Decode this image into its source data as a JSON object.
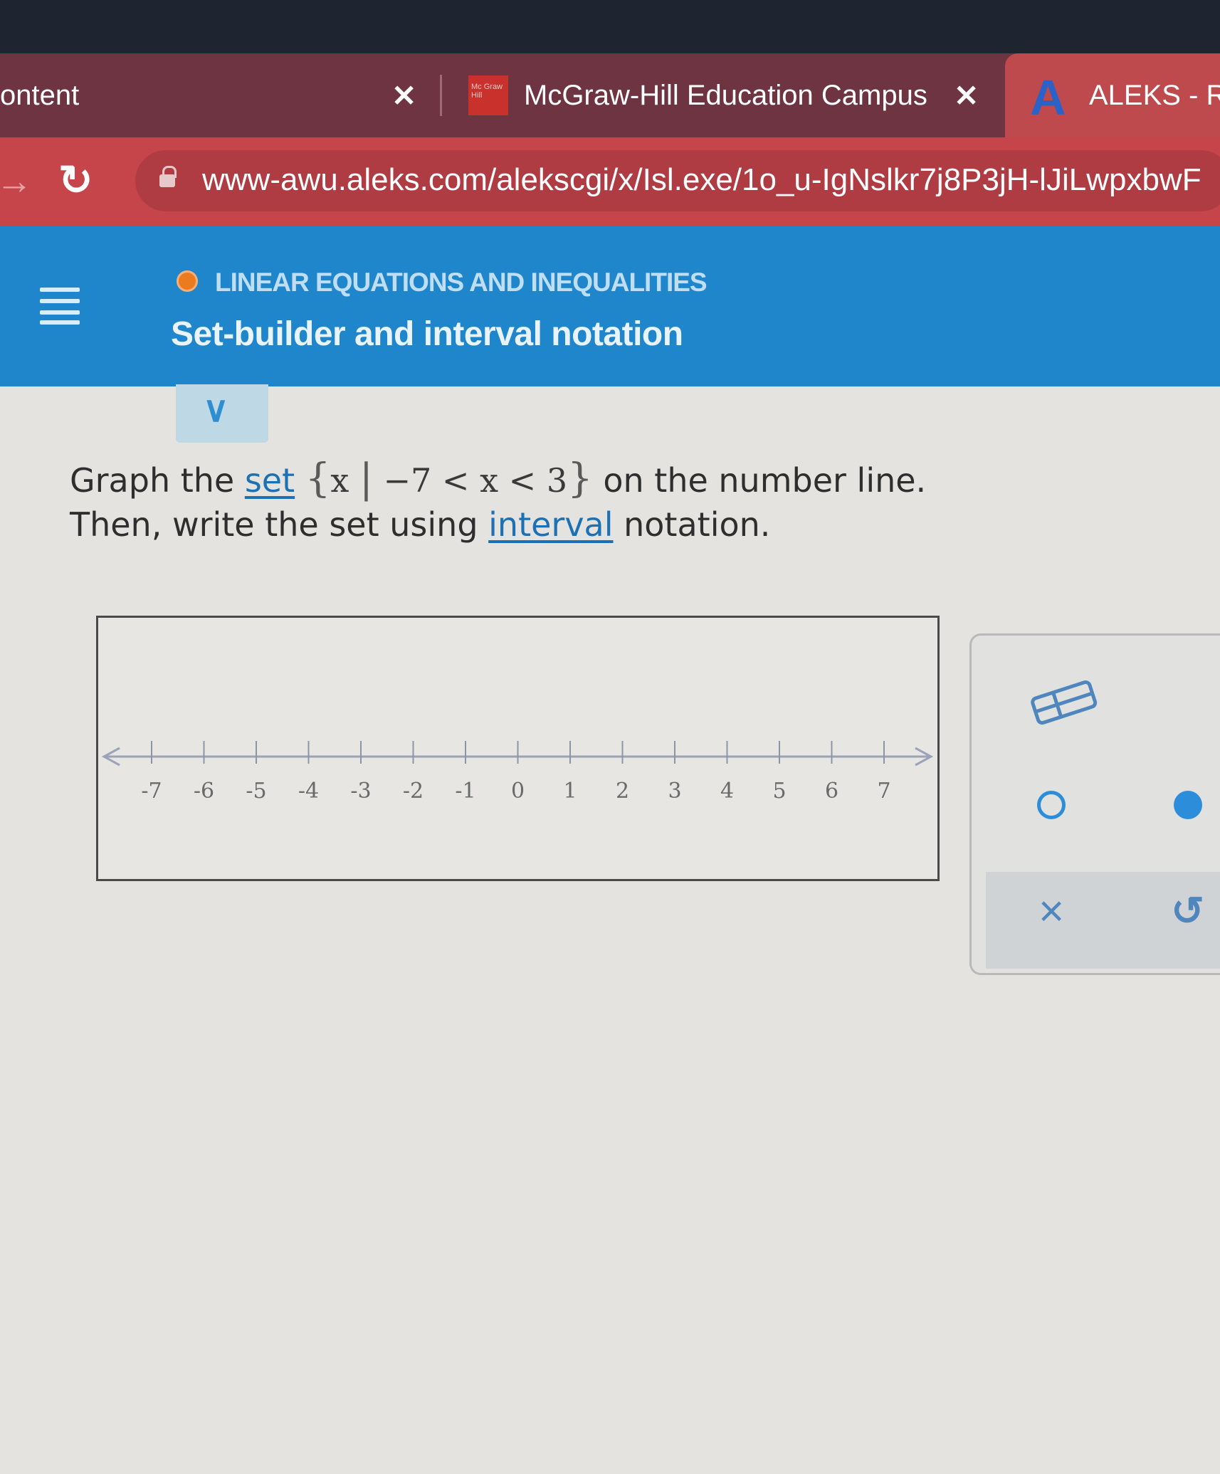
{
  "browser": {
    "tabs": [
      {
        "label": "ontent",
        "close": "✕"
      },
      {
        "label": "McGraw-Hill Education Campus",
        "close": "✕",
        "logo_text": "Mc Graw Hill"
      },
      {
        "label": "ALEKS - R",
        "logo": "A"
      }
    ],
    "url": "www-awu.aleks.com/alekscgi/x/Isl.exe/1o_u-IgNslkr7j8P3jH-lJiLwpxbwF"
  },
  "aleks_header": {
    "topic": "LINEAR EQUATIONS AND INEQUALITIES",
    "title": "Set-builder and interval notation",
    "topic_dot_color": "#ec7a1f"
  },
  "problem": {
    "line1_prefix": "Graph the ",
    "set_link": "set",
    "set_open": "{",
    "set_var": "x",
    "set_bar": "|",
    "set_condition": "−7 < x < 3",
    "set_close": "}",
    "line1_suffix": " on the number line.",
    "line2_prefix": "Then, write the set using ",
    "interval_link": "interval",
    "line2_suffix": " notation."
  },
  "number_line": {
    "min": -7,
    "max": 7,
    "ticks": [
      "-7",
      "-6",
      "-5",
      "-4",
      "-3",
      "-2",
      "-1",
      "0",
      "1",
      "2",
      "3",
      "4",
      "5",
      "6",
      "7"
    ]
  },
  "tools": {
    "eraser": "eraser-icon",
    "open_dot": "open-dot-icon",
    "closed_dot": "closed-dot-icon",
    "clear": "×",
    "undo": "↺",
    "accent_color": "#2c8ddb"
  }
}
